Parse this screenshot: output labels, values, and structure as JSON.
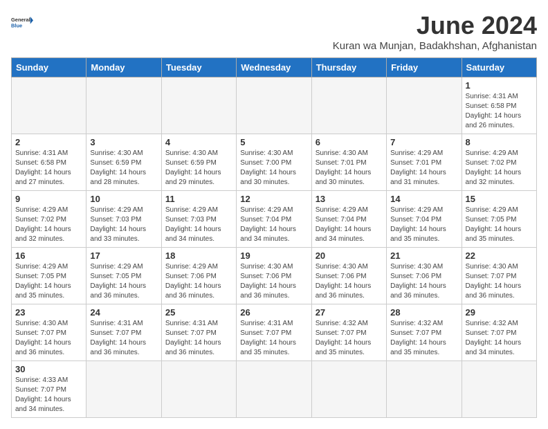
{
  "header": {
    "logo_general": "General",
    "logo_blue": "Blue",
    "title": "June 2024",
    "subtitle": "Kuran wa Munjan, Badakhshan, Afghanistan"
  },
  "days_of_week": [
    "Sunday",
    "Monday",
    "Tuesday",
    "Wednesday",
    "Thursday",
    "Friday",
    "Saturday"
  ],
  "weeks": [
    [
      {
        "day": "",
        "info": ""
      },
      {
        "day": "",
        "info": ""
      },
      {
        "day": "",
        "info": ""
      },
      {
        "day": "",
        "info": ""
      },
      {
        "day": "",
        "info": ""
      },
      {
        "day": "",
        "info": ""
      },
      {
        "day": "1",
        "info": "Sunrise: 4:31 AM\nSunset: 6:58 PM\nDaylight: 14 hours and 26 minutes."
      }
    ],
    [
      {
        "day": "2",
        "info": "Sunrise: 4:31 AM\nSunset: 6:58 PM\nDaylight: 14 hours and 27 minutes."
      },
      {
        "day": "3",
        "info": "Sunrise: 4:30 AM\nSunset: 6:59 PM\nDaylight: 14 hours and 28 minutes."
      },
      {
        "day": "4",
        "info": "Sunrise: 4:30 AM\nSunset: 6:59 PM\nDaylight: 14 hours and 29 minutes."
      },
      {
        "day": "5",
        "info": "Sunrise: 4:30 AM\nSunset: 7:00 PM\nDaylight: 14 hours and 30 minutes."
      },
      {
        "day": "6",
        "info": "Sunrise: 4:30 AM\nSunset: 7:01 PM\nDaylight: 14 hours and 30 minutes."
      },
      {
        "day": "7",
        "info": "Sunrise: 4:29 AM\nSunset: 7:01 PM\nDaylight: 14 hours and 31 minutes."
      },
      {
        "day": "8",
        "info": "Sunrise: 4:29 AM\nSunset: 7:02 PM\nDaylight: 14 hours and 32 minutes."
      }
    ],
    [
      {
        "day": "9",
        "info": "Sunrise: 4:29 AM\nSunset: 7:02 PM\nDaylight: 14 hours and 32 minutes."
      },
      {
        "day": "10",
        "info": "Sunrise: 4:29 AM\nSunset: 7:03 PM\nDaylight: 14 hours and 33 minutes."
      },
      {
        "day": "11",
        "info": "Sunrise: 4:29 AM\nSunset: 7:03 PM\nDaylight: 14 hours and 34 minutes."
      },
      {
        "day": "12",
        "info": "Sunrise: 4:29 AM\nSunset: 7:04 PM\nDaylight: 14 hours and 34 minutes."
      },
      {
        "day": "13",
        "info": "Sunrise: 4:29 AM\nSunset: 7:04 PM\nDaylight: 14 hours and 34 minutes."
      },
      {
        "day": "14",
        "info": "Sunrise: 4:29 AM\nSunset: 7:04 PM\nDaylight: 14 hours and 35 minutes."
      },
      {
        "day": "15",
        "info": "Sunrise: 4:29 AM\nSunset: 7:05 PM\nDaylight: 14 hours and 35 minutes."
      }
    ],
    [
      {
        "day": "16",
        "info": "Sunrise: 4:29 AM\nSunset: 7:05 PM\nDaylight: 14 hours and 35 minutes."
      },
      {
        "day": "17",
        "info": "Sunrise: 4:29 AM\nSunset: 7:05 PM\nDaylight: 14 hours and 36 minutes."
      },
      {
        "day": "18",
        "info": "Sunrise: 4:29 AM\nSunset: 7:06 PM\nDaylight: 14 hours and 36 minutes."
      },
      {
        "day": "19",
        "info": "Sunrise: 4:30 AM\nSunset: 7:06 PM\nDaylight: 14 hours and 36 minutes."
      },
      {
        "day": "20",
        "info": "Sunrise: 4:30 AM\nSunset: 7:06 PM\nDaylight: 14 hours and 36 minutes."
      },
      {
        "day": "21",
        "info": "Sunrise: 4:30 AM\nSunset: 7:06 PM\nDaylight: 14 hours and 36 minutes."
      },
      {
        "day": "22",
        "info": "Sunrise: 4:30 AM\nSunset: 7:07 PM\nDaylight: 14 hours and 36 minutes."
      }
    ],
    [
      {
        "day": "23",
        "info": "Sunrise: 4:30 AM\nSunset: 7:07 PM\nDaylight: 14 hours and 36 minutes."
      },
      {
        "day": "24",
        "info": "Sunrise: 4:31 AM\nSunset: 7:07 PM\nDaylight: 14 hours and 36 minutes."
      },
      {
        "day": "25",
        "info": "Sunrise: 4:31 AM\nSunset: 7:07 PM\nDaylight: 14 hours and 36 minutes."
      },
      {
        "day": "26",
        "info": "Sunrise: 4:31 AM\nSunset: 7:07 PM\nDaylight: 14 hours and 35 minutes."
      },
      {
        "day": "27",
        "info": "Sunrise: 4:32 AM\nSunset: 7:07 PM\nDaylight: 14 hours and 35 minutes."
      },
      {
        "day": "28",
        "info": "Sunrise: 4:32 AM\nSunset: 7:07 PM\nDaylight: 14 hours and 35 minutes."
      },
      {
        "day": "29",
        "info": "Sunrise: 4:32 AM\nSunset: 7:07 PM\nDaylight: 14 hours and 34 minutes."
      }
    ],
    [
      {
        "day": "30",
        "info": "Sunrise: 4:33 AM\nSunset: 7:07 PM\nDaylight: 14 hours and 34 minutes."
      },
      {
        "day": "",
        "info": ""
      },
      {
        "day": "",
        "info": ""
      },
      {
        "day": "",
        "info": ""
      },
      {
        "day": "",
        "info": ""
      },
      {
        "day": "",
        "info": ""
      },
      {
        "day": "",
        "info": ""
      }
    ]
  ]
}
